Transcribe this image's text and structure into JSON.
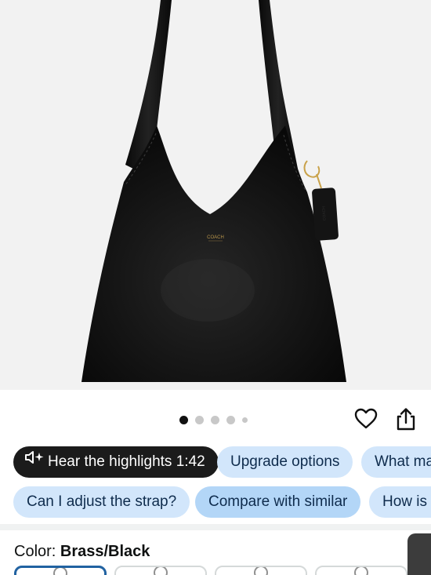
{
  "product": {
    "brand_mark": "COACH",
    "tag_mark": "COACH"
  },
  "gallery": {
    "image_count": 5,
    "active_index": 0,
    "favorite_icon": "heart-icon",
    "share_icon": "share-icon"
  },
  "highlights_chips": [
    {
      "label": "Hear the highlights 1:42",
      "icon": "speaker-sparkle-icon"
    },
    {
      "label": "Upgrade options"
    },
    {
      "label": "What ma"
    }
  ],
  "question_chips": [
    {
      "label": "Can I adjust the strap?"
    },
    {
      "label": "Compare with similar"
    },
    {
      "label": "How is t"
    }
  ],
  "variant": {
    "prefix": "Color: ",
    "selected": "Brass/Black",
    "swatch_count": 4
  },
  "colors": {
    "chip_bg": "#d2e6fb",
    "chip_selected_bg": "#b3d6f7",
    "dark_chip_bg": "#1b1b1b",
    "selected_border": "#2162a1",
    "bag": "#111111",
    "hardware": "#c9a24a"
  }
}
